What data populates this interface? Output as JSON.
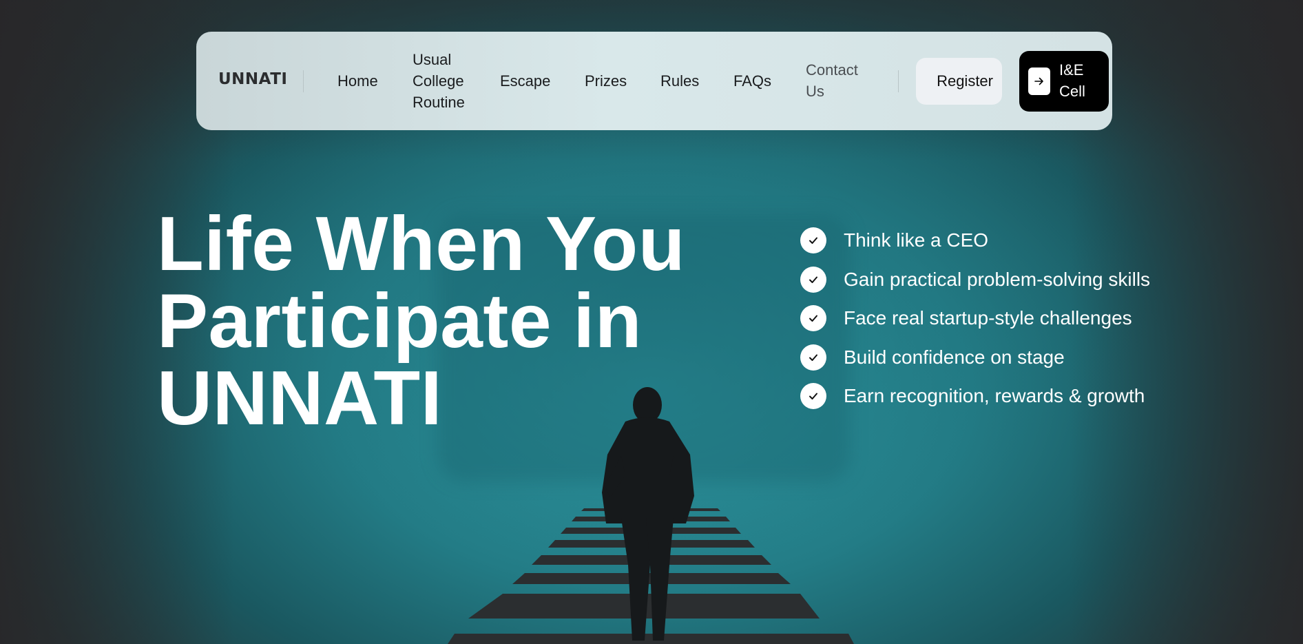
{
  "nav": {
    "logo": "UNNATI",
    "links": [
      "Home",
      "Usual College Routine",
      "Escape",
      "Prizes",
      "Rules",
      "FAQs",
      "Contact Us"
    ],
    "register_label": "Register",
    "ie_cell_label": "I&E Cell",
    "ie_cell_icon": "arrow-right-icon"
  },
  "hero": {
    "title_line1": "Life When You",
    "title_line2": "Participate in",
    "title_line3": "UNNATI",
    "benefits": [
      "Think like a CEO",
      "Gain practical problem-solving skills",
      "Face real startup-style challenges",
      "Build confidence on stage",
      "Earn recognition, rewards & growth"
    ],
    "benefit_icon": "check-icon"
  },
  "colors": {
    "background_teal": "#2f9aa4",
    "navbar": "#d9e8ea",
    "register_button": "#eef1f4",
    "ie_button": "#000000",
    "text_light": "#ffffff"
  }
}
